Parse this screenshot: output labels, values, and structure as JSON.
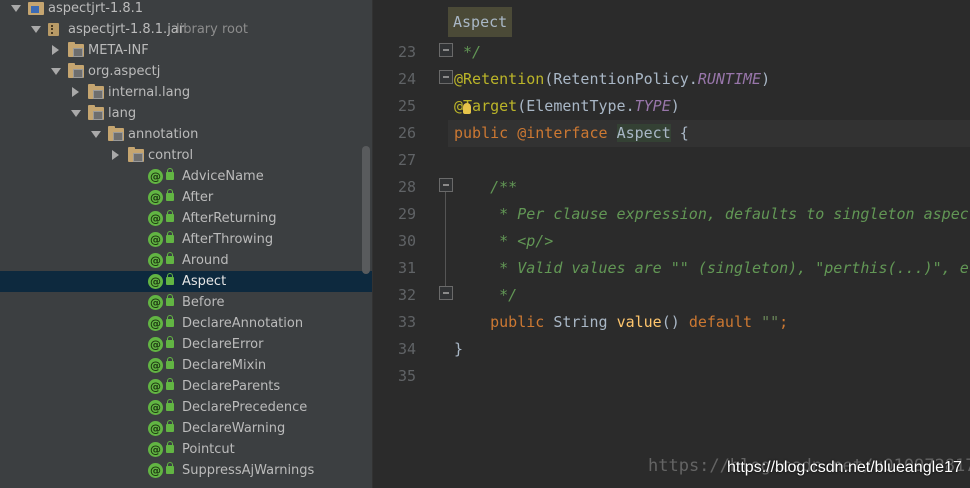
{
  "tree": {
    "rows": [
      {
        "label": "aspectjrt-1.8.1",
        "icon": "module-icon",
        "arrow": "down"
      },
      {
        "label": "aspectjrt-1.8.1.jar",
        "hint": "library root",
        "icon": "jar-icon",
        "arrow": "down"
      },
      {
        "label": "META-INF",
        "icon": "package-folder-icon",
        "arrow": "right"
      },
      {
        "label": "org.aspectj",
        "icon": "package-folder-icon",
        "arrow": "down"
      },
      {
        "label": "internal.lang",
        "icon": "package-folder-icon",
        "arrow": "right"
      },
      {
        "label": "lang",
        "icon": "package-folder-icon",
        "arrow": "down"
      },
      {
        "label": "annotation",
        "icon": "package-folder-icon",
        "arrow": "down"
      },
      {
        "label": "control",
        "icon": "package-folder-icon",
        "arrow": "right"
      },
      {
        "label": "AdviceName",
        "icon": "annotation-icon"
      },
      {
        "label": "After",
        "icon": "annotation-icon"
      },
      {
        "label": "AfterReturning",
        "icon": "annotation-icon"
      },
      {
        "label": "AfterThrowing",
        "icon": "annotation-icon"
      },
      {
        "label": "Around",
        "icon": "annotation-icon"
      },
      {
        "label": "Aspect",
        "icon": "annotation-icon",
        "selected": true
      },
      {
        "label": "Before",
        "icon": "annotation-icon"
      },
      {
        "label": "DeclareAnnotation",
        "icon": "annotation-icon"
      },
      {
        "label": "DeclareError",
        "icon": "annotation-icon"
      },
      {
        "label": "DeclareMixin",
        "icon": "annotation-icon"
      },
      {
        "label": "DeclareParents",
        "icon": "annotation-icon"
      },
      {
        "label": "DeclarePrecedence",
        "icon": "annotation-icon"
      },
      {
        "label": "DeclareWarning",
        "icon": "annotation-icon"
      },
      {
        "label": "Pointcut",
        "icon": "annotation-icon"
      },
      {
        "label": "SuppressAjWarnings",
        "icon": "annotation-icon"
      }
    ]
  },
  "editor": {
    "tab_label": "Aspect",
    "line_numbers": [
      "23",
      "24",
      "25",
      "26",
      "27",
      "28",
      "29",
      "30",
      "31",
      "32",
      "33",
      "34",
      "35"
    ],
    "lines": [
      [
        {
          "t": " */",
          "c": "cm"
        }
      ],
      [
        {
          "t": "@Retention",
          "c": "an"
        },
        {
          "t": "(RetentionPolicy.",
          "c": ""
        },
        {
          "t": "RUNTIME",
          "c": "it"
        },
        {
          "t": ")",
          "c": ""
        }
      ],
      [
        {
          "t": "@Target",
          "c": "an"
        },
        {
          "t": "(ElementType.",
          "c": ""
        },
        {
          "t": "TYPE",
          "c": "it"
        },
        {
          "t": ")",
          "c": ""
        }
      ],
      [
        {
          "t": "public ",
          "c": "kw"
        },
        {
          "t": "@interface ",
          "c": "kw"
        },
        {
          "t": "Aspect",
          "c": "hl"
        },
        {
          "t": " {",
          "c": ""
        }
      ],
      [
        {
          "t": "",
          "c": ""
        }
      ],
      [
        {
          "t": "    /**",
          "c": "cm"
        }
      ],
      [
        {
          "t": "     * Per clause expression, defaults to singleton aspect",
          "c": "cm"
        }
      ],
      [
        {
          "t": "     * <p/>",
          "c": "cm"
        }
      ],
      [
        {
          "t": "     * Valid values are \"\" (singleton), \"perthis(...)\", etc",
          "c": "cm"
        }
      ],
      [
        {
          "t": "     */",
          "c": "cm"
        }
      ],
      [
        {
          "t": "    ",
          "c": ""
        },
        {
          "t": "public ",
          "c": "kw"
        },
        {
          "t": "String ",
          "c": ""
        },
        {
          "t": "value",
          "c": "fn"
        },
        {
          "t": "() ",
          "c": ""
        },
        {
          "t": "default ",
          "c": "kw"
        },
        {
          "t": "\"\"",
          "c": "st"
        },
        {
          "t": ";",
          "c": "kw"
        }
      ],
      [
        {
          "t": "}",
          "c": ""
        }
      ],
      [
        {
          "t": "",
          "c": ""
        }
      ]
    ]
  },
  "watermark": {
    "faint": "https://blog.csdn.net/u010972817",
    "overlay": "https://blog.csdn.net/blueangle17"
  }
}
